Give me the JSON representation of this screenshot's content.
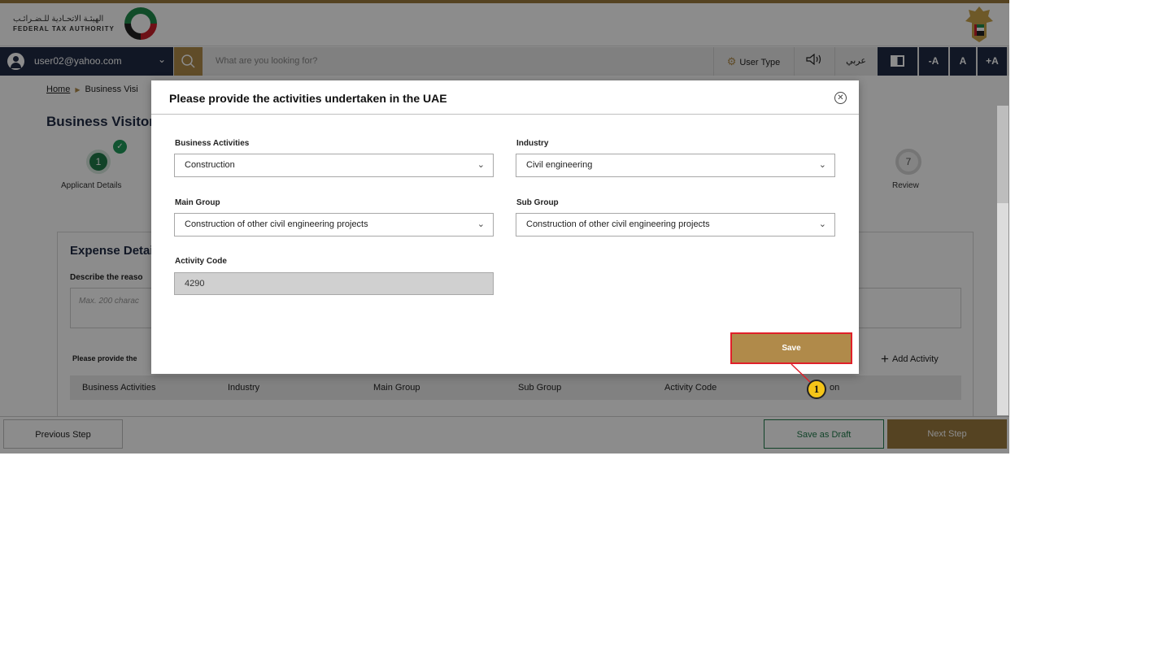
{
  "header": {
    "logo_arabic": "الهيئـة الاتحـادية للـضـرائـب",
    "logo_english": "FEDERAL TAX AUTHORITY"
  },
  "navbar": {
    "user_email": "user02@yahoo.com",
    "search_placeholder": "What are you looking for?",
    "user_type_label": "User Type",
    "arabic_label": "عربي",
    "font_decrease": "-A",
    "font_normal": "A",
    "font_increase": "+A"
  },
  "breadcrumb": {
    "home": "Home",
    "current": "Business Visi"
  },
  "page": {
    "title": "Business Visitor"
  },
  "steps": {
    "step1_number": "1",
    "step1_label": "Applicant Details",
    "step7_number": "7",
    "step7_label": "Review"
  },
  "expense": {
    "title": "Expense Detai",
    "reason_label": "Describe the reaso",
    "reason_placeholder": "Max. 200 charac",
    "activities_prompt": "Please provide the",
    "add_activity": "Add Activity",
    "table_columns": [
      "Business Activities",
      "Industry",
      "Main Group",
      "Sub Group",
      "Activity Code",
      "on"
    ]
  },
  "modal": {
    "title": "Please provide the activities undertaken in the UAE",
    "business_activities_label": "Business Activities",
    "business_activities_value": "Construction",
    "industry_label": "Industry",
    "industry_value": "Civil engineering",
    "main_group_label": "Main Group",
    "main_group_value": "Construction of other civil engineering projects",
    "sub_group_label": "Sub Group",
    "sub_group_value": "Construction of other civil engineering projects",
    "activity_code_label": "Activity Code",
    "activity_code_value": "4290",
    "save_label": "Save"
  },
  "footer": {
    "previous_label": "Previous Step",
    "draft_label": "Save as Draft",
    "next_label": "Next Step"
  },
  "callout": {
    "number": "1"
  },
  "colors": {
    "navy": "#1f2a44",
    "gold": "#b08a4a",
    "green": "#1f7a4a",
    "callout_red": "#e0202a",
    "callout_yellow": "#f5c518"
  }
}
